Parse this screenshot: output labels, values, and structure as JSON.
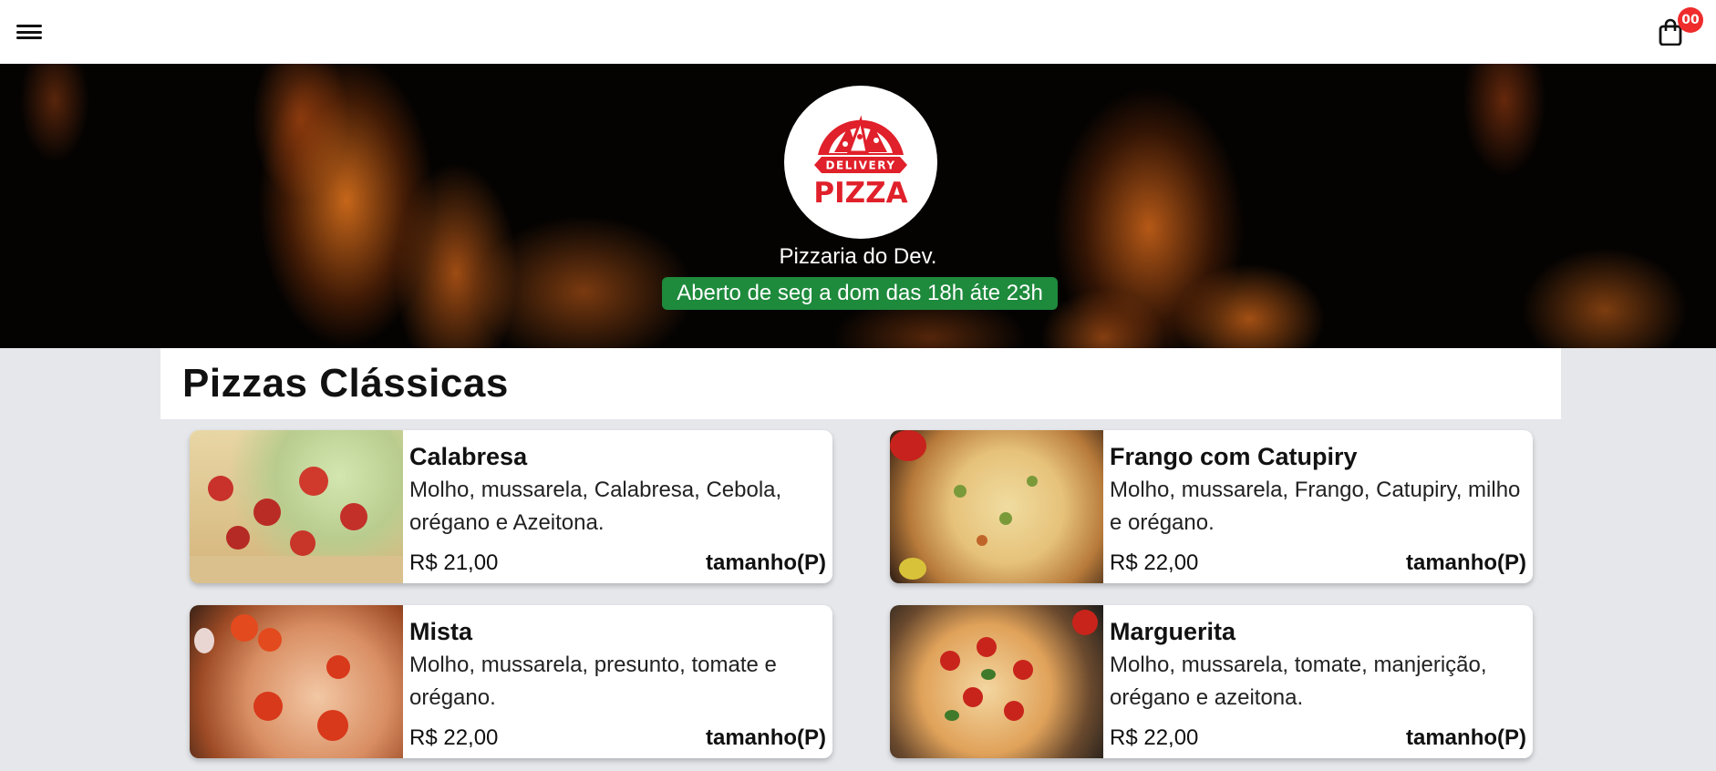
{
  "header": {
    "menu_icon": "hamburger-menu-icon",
    "cart_icon": "shopping-bag-icon",
    "cart_count": "00"
  },
  "hero": {
    "logo": {
      "line1": "DELIVERY",
      "line2": "PIZZA",
      "accent_color": "#e0202a"
    },
    "store_name": "Pizzaria do Dev.",
    "hours": "Aberto de seg a dom das 18h áte 23h",
    "hours_color": "#1e8a3c"
  },
  "section": {
    "title": "Pizzas Clássicas"
  },
  "products": [
    {
      "name": "Calabresa",
      "description": "Molho, mussarela, Calabresa, Cebola, orégano e Azeitona.",
      "price": "R$ 21,00",
      "size": "tamanho(P)"
    },
    {
      "name": "Frango com Catupiry",
      "description": "Molho, mussarela, Frango, Catupiry, milho e orégano.",
      "price": "R$ 22,00",
      "size": "tamanho(P)"
    },
    {
      "name": "Mista",
      "description": "Molho, mussarela, presunto, tomate e orégano.",
      "price": "R$ 22,00",
      "size": "tamanho(P)"
    },
    {
      "name": "Marguerita",
      "description": "Molho, mussarela, tomate, manjerição, orégano e azeitona.",
      "price": "R$ 22,00",
      "size": "tamanho(P)"
    }
  ]
}
